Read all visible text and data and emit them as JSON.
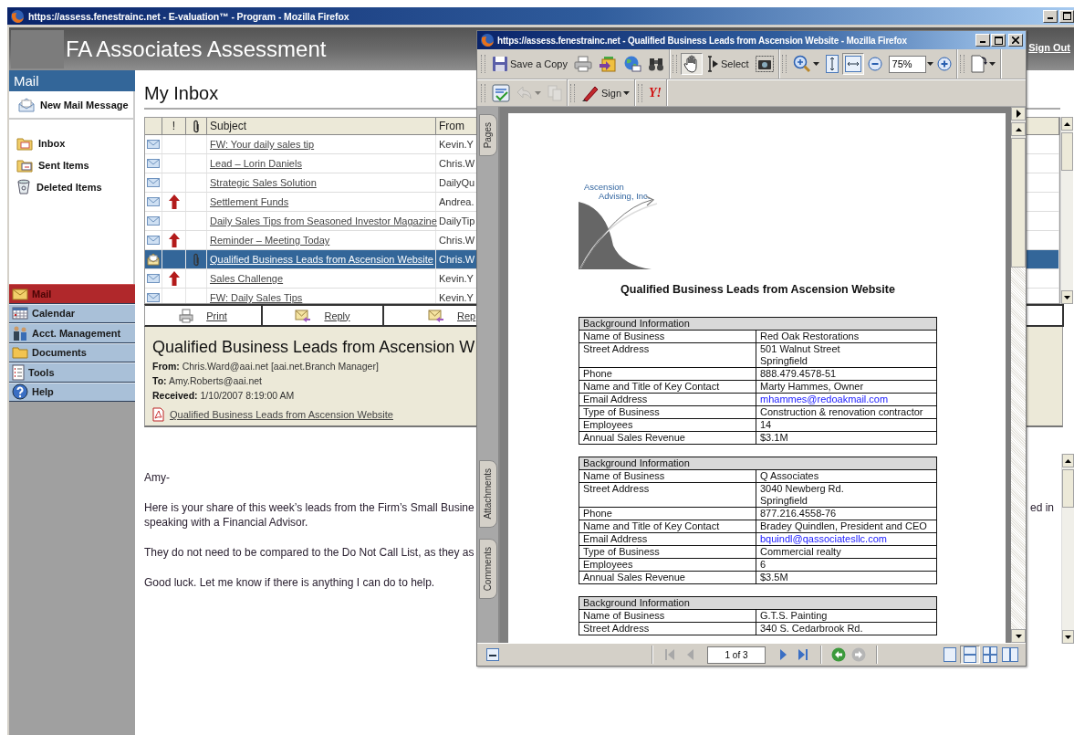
{
  "browser": {
    "title": "https://assess.fenestrainc.net - E-valuation™ - Program - Mozilla Firefox"
  },
  "app": {
    "title": "FA Associates Assessment",
    "sign_out": "Sign Out"
  },
  "sidebar": {
    "header": "Mail",
    "new_message": "New Mail Message",
    "folders": [
      {
        "label": "Inbox"
      },
      {
        "label": "Sent Items"
      },
      {
        "label": "Deleted Items"
      }
    ],
    "nav": [
      {
        "label": "Mail",
        "selected": true
      },
      {
        "label": "Calendar",
        "selected": false
      },
      {
        "label": "Acct. Management",
        "selected": false
      },
      {
        "label": "Documents",
        "selected": false
      },
      {
        "label": "Tools",
        "selected": false
      },
      {
        "label": "Help",
        "selected": false
      }
    ]
  },
  "inbox": {
    "title": "My Inbox",
    "columns": {
      "priority": "!",
      "subject": "Subject",
      "from": "From"
    },
    "rows": [
      {
        "subject": "FW: Your daily sales tip",
        "from": "Kevin.Y",
        "important": false,
        "attachment": false,
        "selected": false
      },
      {
        "subject": "Lead – Lorin Daniels",
        "from": "Chris.W",
        "important": false,
        "attachment": false,
        "selected": false
      },
      {
        "subject": "Strategic Sales Solution",
        "from": "DailyQu",
        "important": false,
        "attachment": false,
        "selected": false
      },
      {
        "subject": "Settlement Funds",
        "from": "Andrea.",
        "important": true,
        "attachment": false,
        "selected": false
      },
      {
        "subject": "Daily Sales Tips from Seasoned Investor Magazine",
        "from": "DailyTip",
        "important": false,
        "attachment": false,
        "selected": false
      },
      {
        "subject": "Reminder – Meeting Today",
        "from": "Chris.W",
        "important": true,
        "attachment": false,
        "selected": false
      },
      {
        "subject": "Qualified Business Leads from Ascension Website",
        "from": "Chris.W",
        "important": false,
        "attachment": true,
        "selected": true
      },
      {
        "subject": "Sales Challenge",
        "from": "Kevin.Y",
        "important": true,
        "attachment": false,
        "selected": false
      },
      {
        "subject": "FW: Daily Sales Tips",
        "from": "Kevin.Y",
        "important": false,
        "attachment": false,
        "selected": false
      }
    ],
    "actions": [
      {
        "label": "Print"
      },
      {
        "label": "Reply"
      },
      {
        "label": "Rep"
      }
    ]
  },
  "message": {
    "title": "Qualified Business Leads from Ascension W",
    "fields": [
      {
        "label": "From:",
        "value": "Chris.Ward@aai.net [aai.net.Branch Manager]"
      },
      {
        "label": "To:",
        "value": "Amy.Roberts@aai.net"
      },
      {
        "label": "Received:",
        "value": "1/10/2007 8:19:00 AM"
      }
    ],
    "attachment": "Qualified Business Leads from Ascension Website",
    "body": [
      {
        "text": "Amy-"
      },
      {
        "text": "Here is your share of this week’s leads from the Firm’s Small Busine\nspeaking with a Financial Advisor.",
        "continued": "ed in"
      },
      {
        "text": "They do not need to be compared to the Do Not Call List, as they as"
      },
      {
        "text": "Good luck.  Let me know if there is anything I can do to help."
      }
    ]
  },
  "viewer": {
    "title": "https://assess.fenestrainc.net - Qualified Business Leads from Ascension Website - Mozilla Firefox",
    "toolbar_rows": [
      [
        [
          {
            "kind": "button",
            "label": "Save a Copy",
            "pressed": false,
            "disabled": false
          },
          {
            "kind": "button",
            "pressed": false,
            "disabled": false
          },
          {
            "kind": "button",
            "pressed": false,
            "disabled": false
          },
          {
            "kind": "button",
            "pressed": false,
            "disabled": false
          },
          {
            "kind": "button",
            "pressed": false,
            "disabled": false
          }
        ],
        [
          {
            "kind": "button",
            "pressed": true,
            "disabled": false
          },
          {
            "kind": "button",
            "label": "Select",
            "pressed": false,
            "disabled": false
          },
          {
            "kind": "button",
            "pressed": false,
            "disabled": false
          }
        ],
        [
          {
            "kind": "menu-button",
            "pressed": false,
            "disabled": false
          },
          {
            "kind": "button",
            "pressed": false,
            "disabled": false
          },
          {
            "kind": "button",
            "pressed": true,
            "disabled": false
          },
          {
            "kind": "button",
            "pressed": false,
            "disabled": false
          },
          {
            "kind": "field",
            "value": "75%"
          },
          {
            "kind": "button",
            "pressed": false,
            "disabled": false
          }
        ],
        [
          {
            "kind": "menu-button",
            "pressed": false,
            "disabled": false
          }
        ]
      ],
      [
        [
          {
            "kind": "button",
            "pressed": false,
            "disabled": false
          },
          {
            "kind": "menu-button",
            "pressed": false,
            "disabled": true
          },
          {
            "kind": "button",
            "pressed": false,
            "disabled": true
          }
        ],
        [
          {
            "kind": "menu-button",
            "label": "Sign",
            "pressed": false,
            "disabled": false
          }
        ],
        [
          {
            "kind": "text-button",
            "label": "Y!",
            "pressed": false,
            "disabled": false
          }
        ]
      ]
    ],
    "side_tabs": [
      {
        "label": "Pages"
      },
      {
        "label": "Attachments"
      },
      {
        "label": "Comments"
      }
    ],
    "page_nav": [
      {
        "kind": "button",
        "disabled": true
      },
      {
        "kind": "button",
        "disabled": true
      },
      {
        "kind": "field",
        "value": "1 of 3"
      },
      {
        "kind": "button",
        "disabled": false
      },
      {
        "kind": "button",
        "disabled": false
      }
    ],
    "history": [
      {
        "disabled": false
      },
      {
        "disabled": true
      }
    ],
    "views": [
      {
        "selected": false
      },
      {
        "selected": true
      },
      {
        "selected": false
      },
      {
        "selected": false
      }
    ],
    "document": {
      "logo": [
        "Ascension",
        "Advising, Inc."
      ],
      "heading": "Qualified Business Leads from Ascension Website",
      "tables": [
        {
          "header": "Background Information",
          "rows": [
            {
              "kind": "text",
              "label": "Name of Business",
              "value": "Red Oak Restorations"
            },
            {
              "kind": "text",
              "label": "Street Address",
              "value": "501 Walnut Street\nSpringfield"
            },
            {
              "kind": "text",
              "label": "Phone",
              "value": "888.479.4578-51"
            },
            {
              "kind": "text",
              "label": "Name and Title of Key Contact",
              "value": "Marty Hammes, Owner"
            },
            {
              "kind": "link",
              "label": "Email Address",
              "value": "mhammes@redoakmail.com"
            },
            {
              "kind": "text",
              "label": "Type of Business",
              "value": "Construction & renovation contractor"
            },
            {
              "kind": "text",
              "label": "Employees",
              "value": "14"
            },
            {
              "kind": "text",
              "label": "Annual Sales Revenue",
              "value": "$3.1M"
            }
          ]
        },
        {
          "header": "Background Information",
          "rows": [
            {
              "kind": "text",
              "label": "Name of Business",
              "value": "Q Associates"
            },
            {
              "kind": "text",
              "label": "Street Address",
              "value": "3040 Newberg Rd.\nSpringfield"
            },
            {
              "kind": "text",
              "label": "Phone",
              "value": "877.216.4558-76"
            },
            {
              "kind": "text",
              "label": "Name and Title of Key Contact",
              "value": "Bradey Quindlen, President and CEO"
            },
            {
              "kind": "link",
              "label": "Email Address",
              "value": "bquindl@qassociatesllc.com"
            },
            {
              "kind": "text",
              "label": "Type of Business",
              "value": "Commercial realty"
            },
            {
              "kind": "text",
              "label": "Employees",
              "value": "6"
            },
            {
              "kind": "text",
              "label": "Annual Sales Revenue",
              "value": "$3.5M"
            }
          ]
        },
        {
          "header": "Background Information",
          "rows": [
            {
              "kind": "text",
              "label": "Name of Business",
              "value": "G.T.S. Painting"
            },
            {
              "kind": "text",
              "label": "Street Address",
              "value": "340 S. Cedarbrook Rd."
            }
          ]
        }
      ]
    }
  }
}
